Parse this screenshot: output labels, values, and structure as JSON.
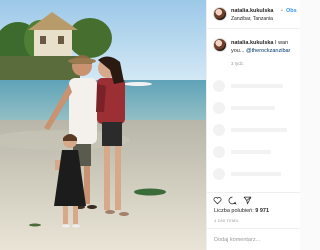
{
  "post": {
    "username": "natalia.kukulska",
    "separator": "•",
    "follow_label": "Obs",
    "location": "Zanzibar, Tanzania"
  },
  "caption": {
    "username": "natalia.kukulska",
    "line1_text": " I wan",
    "line2_start": "you... ",
    "line2_mention": "@therockzanzibar",
    "time": "3 tydz."
  },
  "actions": {
    "like_icon": "heart-icon",
    "comment_icon": "comment-icon",
    "share_icon": "share-icon"
  },
  "likes": {
    "label": "Liczba polubień: ",
    "count": "9 971"
  },
  "date_ago": "4 DNI TEMU",
  "comment_placeholder": "Dodaj komentarz...",
  "colors": {
    "link": "#3897f0",
    "mention": "#003569",
    "text": "#262626",
    "muted": "#999999"
  }
}
